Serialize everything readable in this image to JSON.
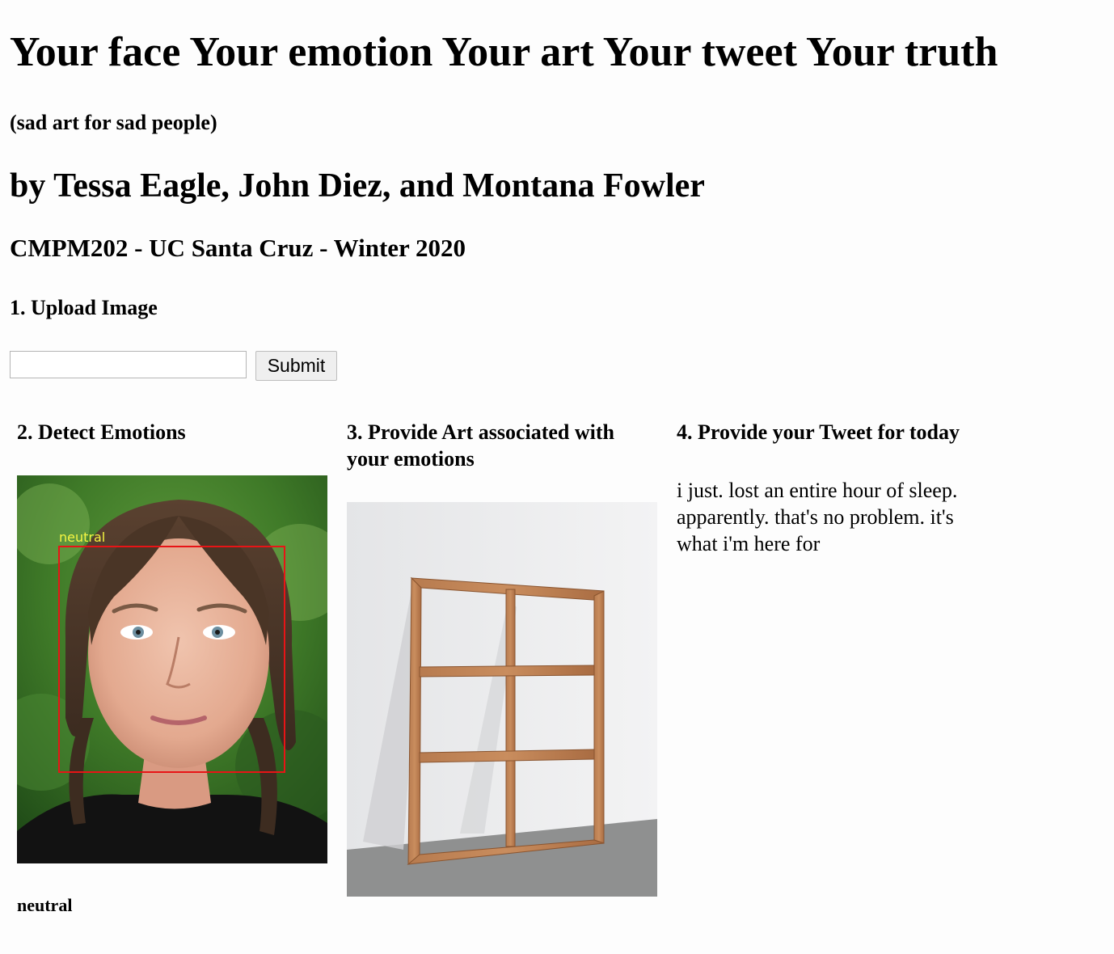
{
  "header": {
    "title": "Your face Your emotion Your art Your tweet Your truth",
    "tagline": "(sad art for sad people)",
    "authors": "by Tessa Eagle, John Diez, and Montana Fowler",
    "course": "CMPM202 - UC Santa Cruz - Winter 2020"
  },
  "upload": {
    "heading": "1. Upload Image",
    "input_value": "",
    "input_placeholder": "",
    "submit_label": "Submit"
  },
  "emotions": {
    "heading": "2. Detect Emotions",
    "face_label": "neutral",
    "result": "neutral",
    "box_color": "#e81416",
    "label_color": "#f5f542"
  },
  "art": {
    "heading": "3. Provide Art associated with your emotions"
  },
  "tweet": {
    "heading": "4. Provide your Tweet for today",
    "text": "i just. lost an entire hour of sleep. apparently. that's no problem. it's what i'm here for"
  }
}
